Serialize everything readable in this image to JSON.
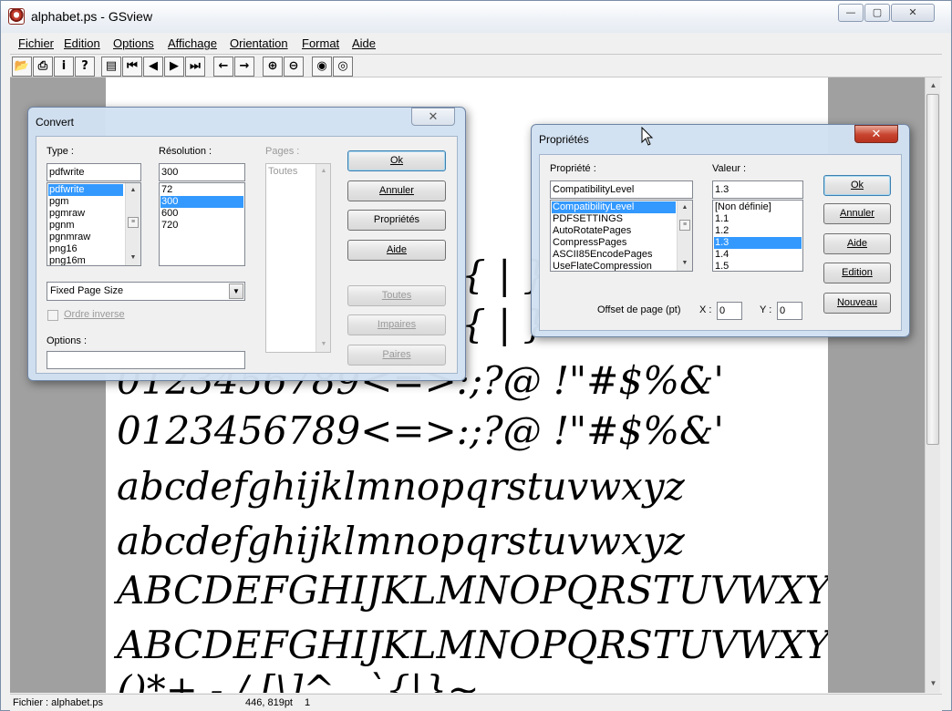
{
  "window": {
    "title": "alphabet.ps - GSview",
    "min_glyph": "—",
    "max_glyph": "▢",
    "close_glyph": "✕"
  },
  "menu": [
    "Fichier",
    "Edition",
    "Options",
    "Affichage",
    "Orientation",
    "Format",
    "Aide"
  ],
  "toolbar": {
    "icons": [
      {
        "name": "open-icon",
        "glyph": "📂"
      },
      {
        "name": "print-icon",
        "glyph": "⎙"
      },
      {
        "name": "info-icon",
        "glyph": "i"
      },
      {
        "name": "help-icon",
        "glyph": "?"
      },
      {
        "name": "page-select-icon",
        "glyph": "▤"
      },
      {
        "name": "first-page-icon",
        "glyph": "⏮"
      },
      {
        "name": "prev-page-icon",
        "glyph": "◀"
      },
      {
        "name": "next-page-icon",
        "glyph": "▶"
      },
      {
        "name": "last-page-icon",
        "glyph": "⏭"
      },
      {
        "name": "back-icon",
        "glyph": "←"
      },
      {
        "name": "forward-icon",
        "glyph": "→"
      },
      {
        "name": "zoom-in-icon",
        "glyph": "⊕"
      },
      {
        "name": "zoom-out-icon",
        "glyph": "⊖"
      },
      {
        "name": "view-text-icon",
        "glyph": "◉"
      },
      {
        "name": "view-eye-icon",
        "glyph": "◎"
      }
    ]
  },
  "document": {
    "lines": [
      "{ | }",
      "{ | }",
      "0123456789<=>:;?@  !\"#$%&'",
      "0123456789<=>:;?@  !\"#$%&'",
      "abcdefghijklmnopqrstuvwxyz",
      "abcdefghijklmnopqrstuvwxyz",
      "ABCDEFGHIJKLMNOPQRSTUVWXYZ",
      "ABCDEFGHIJKLMNOPQRSTUVWXYZ",
      "()*+,-./  [\\]^_  `{|}~"
    ]
  },
  "status": {
    "file": "Fichier : alphabet.ps",
    "coords": "446, 819pt",
    "page": "1"
  },
  "convert": {
    "title": "Convert",
    "type_label": "Type :",
    "type_value": "pdfwrite",
    "type_list": [
      "pdfwrite",
      "pgm",
      "pgmraw",
      "pgnm",
      "pgnmraw",
      "png16",
      "png16m"
    ],
    "type_selected": 0,
    "resolution_label": "Résolution :",
    "resolution_value": "300",
    "resolution_list": [
      "72",
      "300",
      "600",
      "720"
    ],
    "resolution_selected": 1,
    "pages_label": "Pages :",
    "pages_list": [
      "Toutes"
    ],
    "page_size": "Fixed Page Size",
    "reverse_label": "Ordre inverse",
    "options_label": "Options :",
    "options_value": "",
    "buttons": {
      "ok": "Ok",
      "cancel": "Annuler",
      "properties": "Propriétés",
      "help": "Aide",
      "all": "Toutes",
      "odd": "Impaires",
      "even": "Paires"
    }
  },
  "props": {
    "title": "Propriétés",
    "property_label": "Propriété :",
    "property_value": "CompatibilityLevel",
    "property_list": [
      "CompatibilityLevel",
      "PDFSETTINGS",
      "AutoRotatePages",
      "CompressPages",
      "ASCII85EncodePages",
      "UseFlateCompression"
    ],
    "property_selected": 0,
    "value_label": "Valeur :",
    "value_value": "1.3",
    "value_list": [
      "[Non définie]",
      "1.1",
      "1.2",
      "1.3",
      "1.4",
      "1.5"
    ],
    "value_selected": 3,
    "offset_label": "Offset de page (pt)",
    "x_label": "X :",
    "x_value": "0",
    "y_label": "Y :",
    "y_value": "0",
    "buttons": {
      "ok": "Ok",
      "cancel": "Annuler",
      "help": "Aide",
      "edit": "Edition",
      "new": "Nouveau"
    }
  }
}
